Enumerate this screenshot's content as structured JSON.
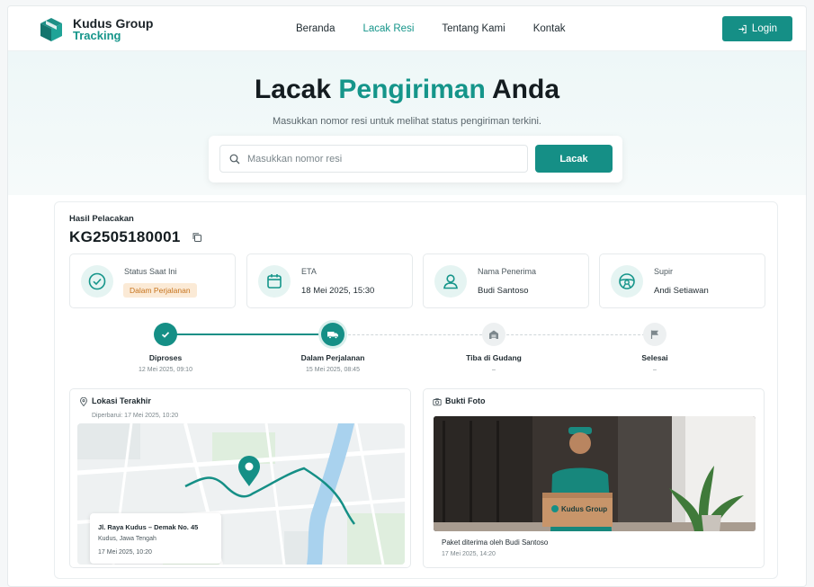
{
  "brand": {
    "title": "Kudus Group",
    "subtitle": "Tracking",
    "accent_color": "#15958a"
  },
  "nav": {
    "items": [
      {
        "label": "Beranda",
        "active": false
      },
      {
        "label": "Lacak Resi",
        "active": true
      },
      {
        "label": "Tentang Kami",
        "active": false
      },
      {
        "label": "Kontak",
        "active": false
      }
    ],
    "login_label": "Login",
    "login_icon": "login-icon"
  },
  "hero": {
    "title_part1": "Lacak",
    "title_accent": "Pengiriman",
    "title_part2": "Anda",
    "subtitle": "Masukkan nomor resi untuk melihat status pengiriman terkini.",
    "search_placeholder": "Masukkan nomor resi",
    "search_value": "",
    "search_button": "Lacak"
  },
  "result": {
    "label": "Hasil Pelacakan",
    "tracking_number": "KG2505180001",
    "info": {
      "status": {
        "label": "Status Saat Ini",
        "value": "Dalam Perjalanan",
        "icon": "check-circle-icon"
      },
      "eta": {
        "label": "ETA",
        "value": "18 Mei 2025, 15:30",
        "icon": "calendar-icon"
      },
      "recipient": {
        "label": "Nama Penerima",
        "value": "Budi Santoso",
        "icon": "user-icon"
      },
      "driver": {
        "label": "Supir",
        "value": "Andi Setiawan",
        "icon": "steering-wheel-icon"
      }
    },
    "timeline": [
      {
        "label": "Diproses",
        "date": "12 Mei 2025, 09:10",
        "state": "done",
        "icon": "check-icon"
      },
      {
        "label": "Dalam Perjalanan",
        "date": "15 Mei 2025, 08:45",
        "state": "current",
        "icon": "truck-icon"
      },
      {
        "label": "Tiba di Gudang",
        "date": "–",
        "state": "todo",
        "icon": "warehouse-icon"
      },
      {
        "label": "Selesai",
        "date": "–",
        "state": "todo",
        "icon": "flag-icon"
      }
    ],
    "location": {
      "title": "Lokasi Terakhir",
      "updated": "Diperbarui: 17 Mei 2025, 10:20",
      "address_line1": "Jl. Raya Kudus – Demak No. 45",
      "address_line2": "Kudus, Jawa Tengah",
      "address_time": "17 Mei 2025, 10:20"
    },
    "photo": {
      "title": "Bukti Foto",
      "caption": "Paket diterima oleh Budi Santoso",
      "date": "17 Mei 2025, 14:20",
      "box_text": "Kudus Group"
    }
  }
}
